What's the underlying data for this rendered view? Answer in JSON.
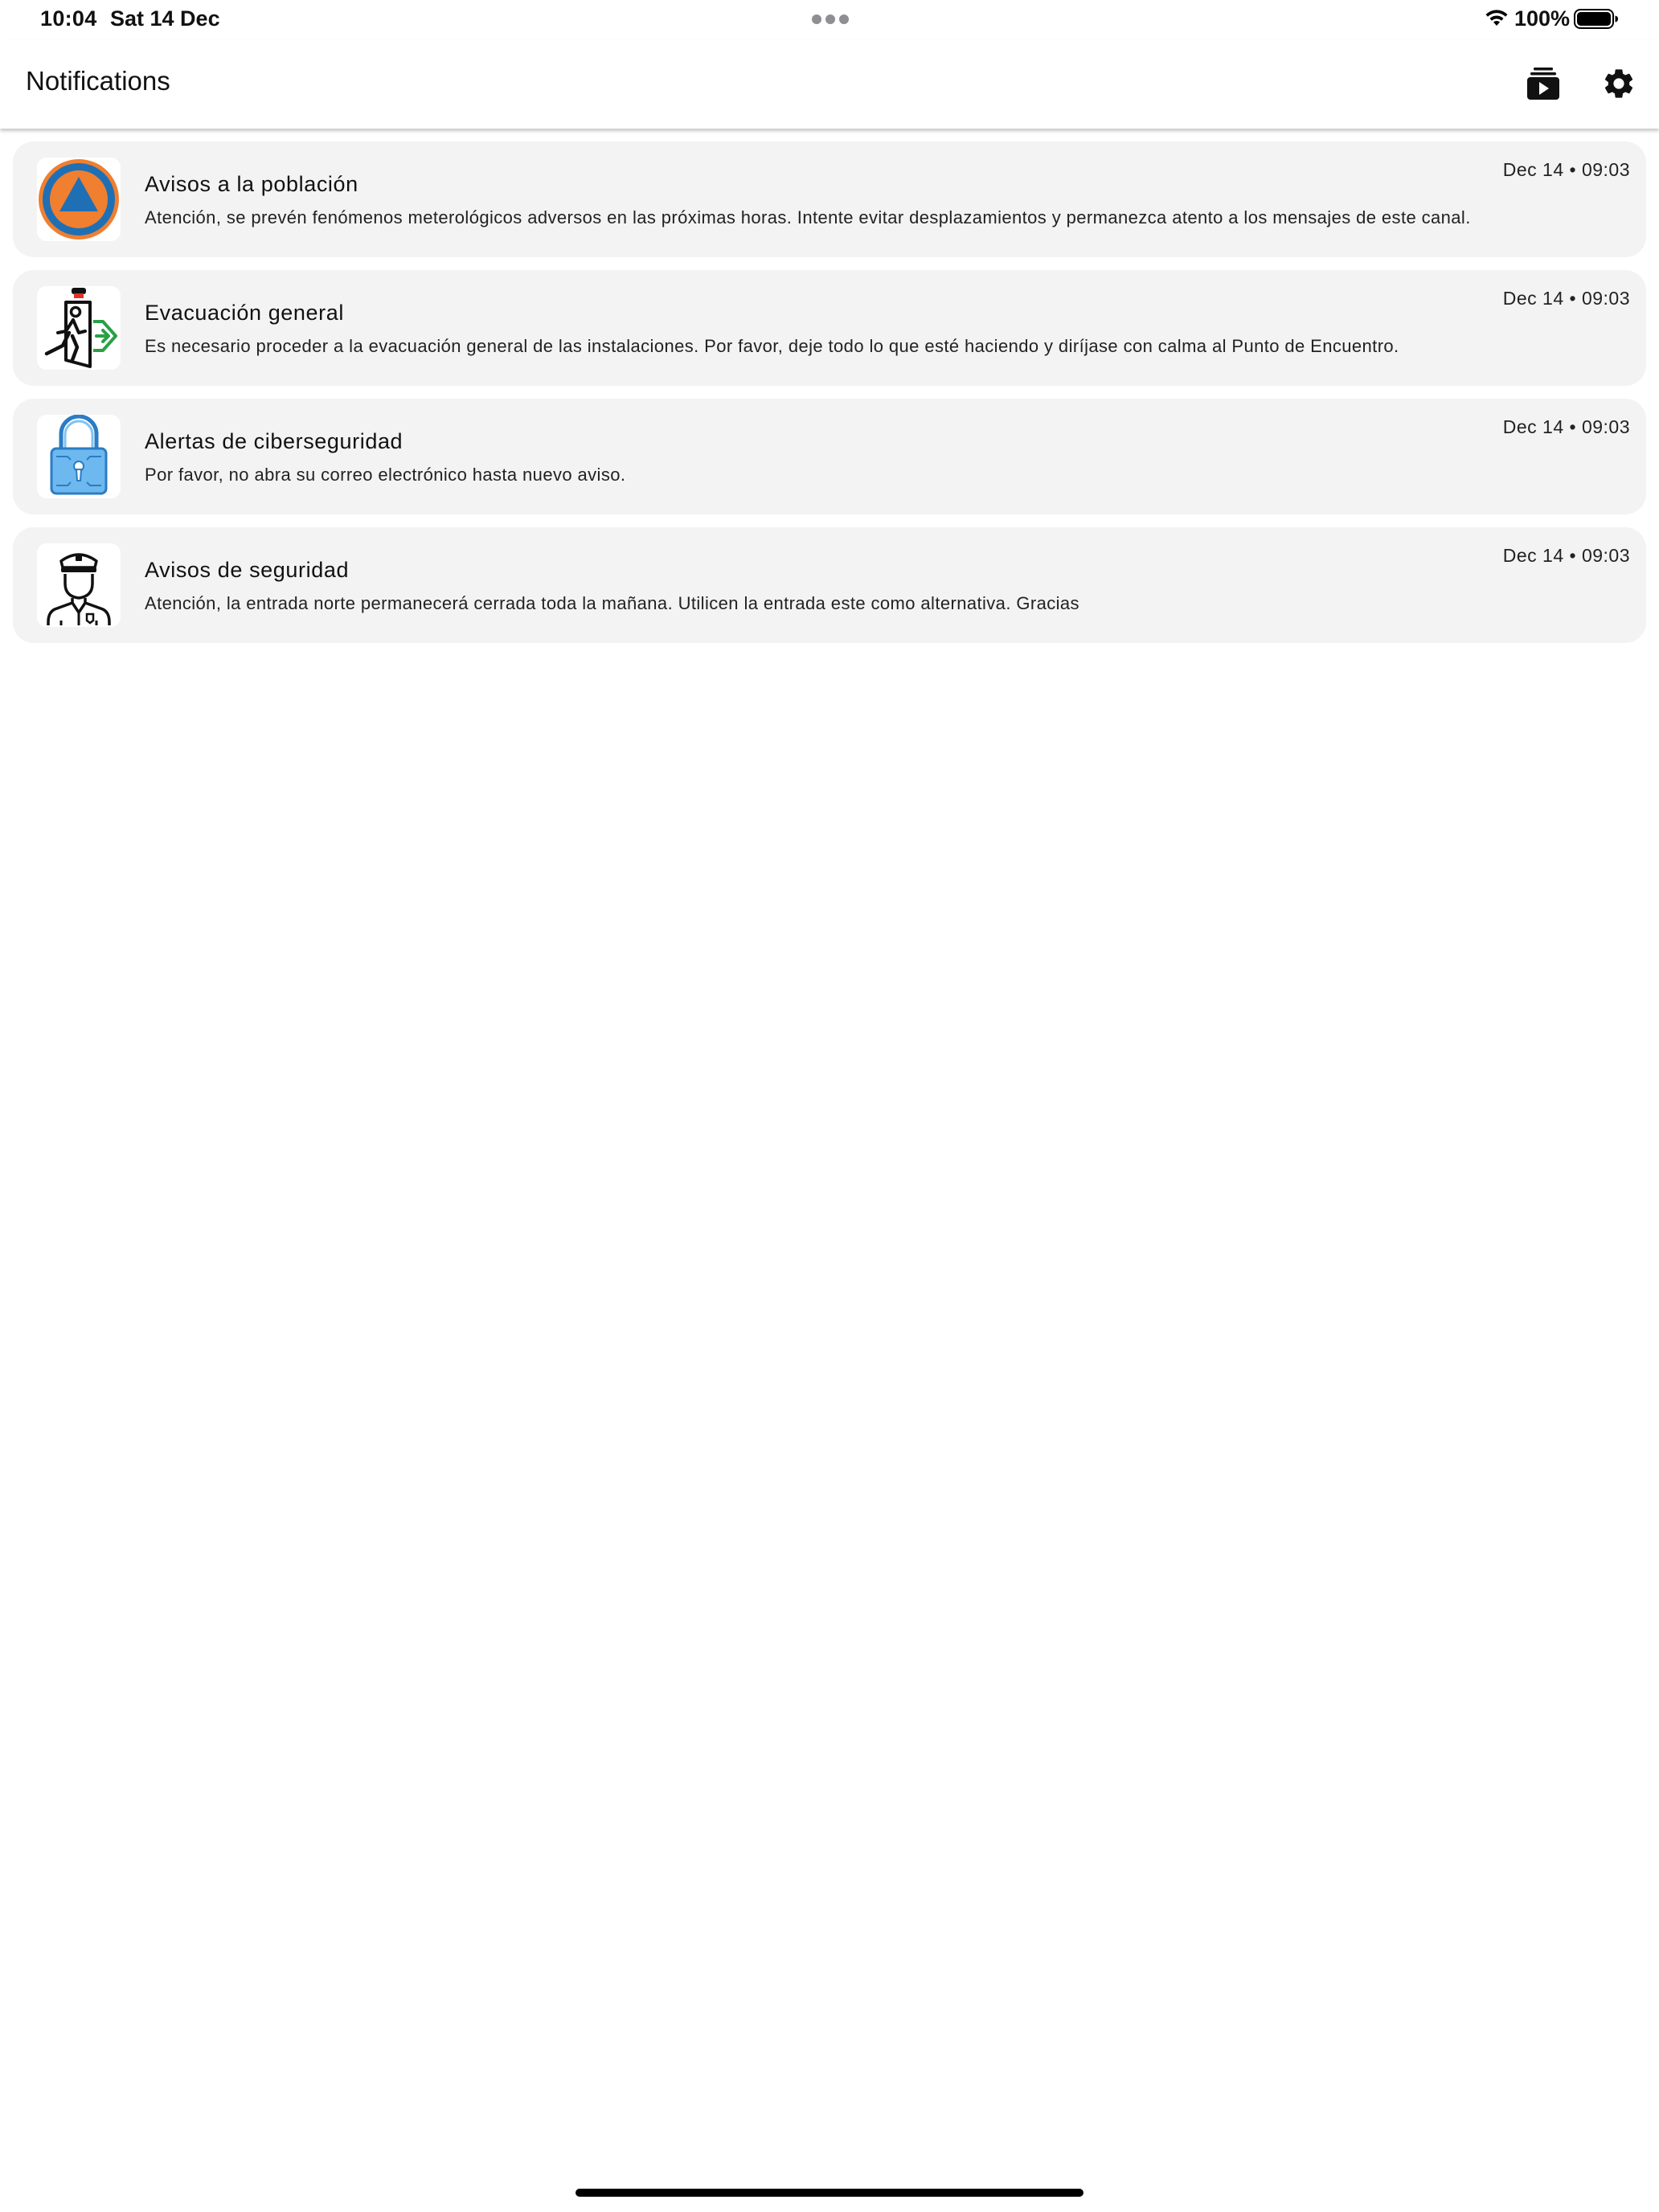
{
  "status_bar": {
    "time": "10:04",
    "date": "Sat 14 Dec",
    "battery": "100%"
  },
  "header": {
    "title": "Notifications",
    "actions": [
      {
        "icon": "media-library-icon"
      },
      {
        "icon": "gear-icon"
      }
    ]
  },
  "notifications": [
    {
      "title": "Avisos a la población",
      "body": "Atención, se prevén fenómenos meterológicos adversos en las próximas horas. Intente evitar desplazamientos y permanezca atento a los mensajes de este canal.",
      "time": "Dec 14 • 09:03",
      "icon": "civil-protection-icon"
    },
    {
      "title": "Evacuación general",
      "body": "Es necesario proceder a la evacuación general de las instalaciones. Por favor, deje todo lo que esté haciendo y diríjase con calma al Punto de Encuentro.",
      "time": "Dec 14 • 09:03",
      "icon": "emergency-exit-icon"
    },
    {
      "title": "Alertas de ciberseguridad",
      "body": "Por favor, no abra su correo electrónico hasta nuevo aviso.",
      "time": "Dec 14 • 09:03",
      "icon": "cyber-lock-icon"
    },
    {
      "title": "Avisos de seguridad",
      "body": "Atención, la entrada norte permanecerá cerrada toda la mañana. Utilicen la entrada este como alternativa. Gracias",
      "time": "Dec 14 • 09:03",
      "icon": "security-guard-icon"
    }
  ],
  "colors": {
    "card_background": "#f3f3f3",
    "civil_protection_blue": "#1f6fb5",
    "civil_protection_orange": "#f07f2f",
    "exit_green": "#2aa046",
    "lock_blue": "#4aa3e8"
  }
}
